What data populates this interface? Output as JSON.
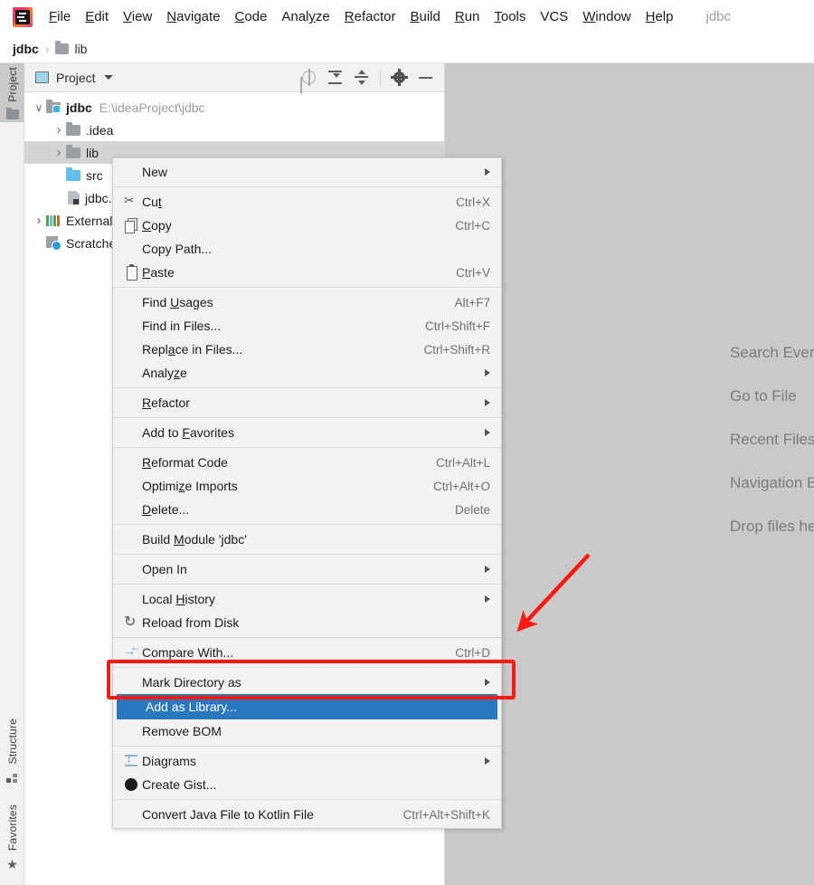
{
  "app": {
    "logo_icon": "intellij-idea-logo",
    "project_name": "jdbc"
  },
  "menubar": {
    "items": [
      {
        "label": "File",
        "mnemonic": "F"
      },
      {
        "label": "Edit",
        "mnemonic": "E"
      },
      {
        "label": "View",
        "mnemonic": "V"
      },
      {
        "label": "Navigate",
        "mnemonic": "N"
      },
      {
        "label": "Code",
        "mnemonic": "C"
      },
      {
        "label": "Analyze",
        "mnemonic": "y"
      },
      {
        "label": "Refactor",
        "mnemonic": "R"
      },
      {
        "label": "Build",
        "mnemonic": "B"
      },
      {
        "label": "Run",
        "mnemonic": "R"
      },
      {
        "label": "Tools",
        "mnemonic": "T"
      },
      {
        "label": "VCS",
        "mnemonic": ""
      },
      {
        "label": "Window",
        "mnemonic": "W"
      },
      {
        "label": "Help",
        "mnemonic": "H"
      }
    ]
  },
  "breadcrumb": {
    "root": "jdbc",
    "separator": "›",
    "folder_icon": "folder-icon",
    "current": "lib"
  },
  "stripe": {
    "buttons": [
      {
        "label": "Project",
        "icon": "folder-icon",
        "active": true
      },
      {
        "label": "Structure",
        "icon": "structure-icon",
        "active": false
      },
      {
        "label": "Favorites",
        "icon": "star-icon",
        "active": false
      }
    ]
  },
  "project_panel": {
    "title": "Project",
    "title_icon": "project-view-icon",
    "caret_icon": "chevron-down-icon",
    "toolbar": [
      {
        "name": "select-opened-file-icon",
        "tooltip": "Select Opened File"
      },
      {
        "name": "expand-all-icon",
        "tooltip": "Expand All"
      },
      {
        "name": "collapse-all-icon",
        "tooltip": "Collapse All"
      },
      {
        "name": "settings-gear-icon",
        "tooltip": "Settings"
      },
      {
        "name": "hide-icon",
        "tooltip": "Hide"
      }
    ],
    "tree": [
      {
        "label": "jdbc",
        "path": "E:\\ideaProject\\jdbc",
        "icon": "module-folder-icon",
        "arrow": "open",
        "indent": 0,
        "bold": true,
        "selected": false
      },
      {
        "label": ".idea",
        "path": "",
        "icon": "folder-icon",
        "arrow": "closed",
        "indent": 1,
        "bold": false,
        "selected": false
      },
      {
        "label": "lib",
        "path": "",
        "icon": "folder-icon",
        "arrow": "closed",
        "indent": 1,
        "bold": false,
        "selected": true
      },
      {
        "label": "src",
        "path": "",
        "icon": "source-folder-icon",
        "arrow": "none",
        "indent": 1,
        "bold": false,
        "selected": false
      },
      {
        "label": "jdbc.iml",
        "path": "",
        "icon": "iml-file-icon",
        "arrow": "none",
        "indent": 1,
        "bold": false,
        "selected": false
      },
      {
        "label": "External Libraries",
        "path": "",
        "icon": "external-libraries-icon",
        "arrow": "closed",
        "indent": 0,
        "bold": false,
        "selected": false
      },
      {
        "label": "Scratches and Consoles",
        "path": "",
        "icon": "scratches-icon",
        "arrow": "none",
        "indent": 0,
        "bold": false,
        "selected": false
      }
    ]
  },
  "editor": {
    "hints": [
      "Search Everywhere",
      "Go to File",
      "Recent Files",
      "Navigation Bar",
      "Drop files here to open"
    ]
  },
  "context_menu": {
    "items": [
      {
        "label": "New",
        "mnemonic": "",
        "shortcut": "",
        "icon": "",
        "submenu": true,
        "selected": false,
        "separator_after": true
      },
      {
        "label": "Cut",
        "mnemonic": "t",
        "shortcut": "Ctrl+X",
        "icon": "cut-icon",
        "submenu": false,
        "selected": false,
        "separator_after": false
      },
      {
        "label": "Copy",
        "mnemonic": "C",
        "shortcut": "Ctrl+C",
        "icon": "copy-icon",
        "submenu": false,
        "selected": false,
        "separator_after": false
      },
      {
        "label": "Copy Path...",
        "mnemonic": "",
        "shortcut": "",
        "icon": "",
        "submenu": false,
        "selected": false,
        "separator_after": false
      },
      {
        "label": "Paste",
        "mnemonic": "P",
        "shortcut": "Ctrl+V",
        "icon": "paste-icon",
        "submenu": false,
        "selected": false,
        "separator_after": true
      },
      {
        "label": "Find Usages",
        "mnemonic": "U",
        "shortcut": "Alt+F7",
        "icon": "",
        "submenu": false,
        "selected": false,
        "separator_after": false
      },
      {
        "label": "Find in Files...",
        "mnemonic": "",
        "shortcut": "Ctrl+Shift+F",
        "icon": "",
        "submenu": false,
        "selected": false,
        "separator_after": false
      },
      {
        "label": "Replace in Files...",
        "mnemonic": "a",
        "shortcut": "Ctrl+Shift+R",
        "icon": "",
        "submenu": false,
        "selected": false,
        "separator_after": false
      },
      {
        "label": "Analyze",
        "mnemonic": "z",
        "shortcut": "",
        "icon": "",
        "submenu": true,
        "selected": false,
        "separator_after": true
      },
      {
        "label": "Refactor",
        "mnemonic": "R",
        "shortcut": "",
        "icon": "",
        "submenu": true,
        "selected": false,
        "separator_after": true
      },
      {
        "label": "Add to Favorites",
        "mnemonic": "F",
        "shortcut": "",
        "icon": "",
        "submenu": true,
        "selected": false,
        "separator_after": true
      },
      {
        "label": "Reformat Code",
        "mnemonic": "R",
        "shortcut": "Ctrl+Alt+L",
        "icon": "",
        "submenu": false,
        "selected": false,
        "separator_after": false
      },
      {
        "label": "Optimize Imports",
        "mnemonic": "z",
        "shortcut": "Ctrl+Alt+O",
        "icon": "",
        "submenu": false,
        "selected": false,
        "separator_after": false
      },
      {
        "label": "Delete...",
        "mnemonic": "D",
        "shortcut": "Delete",
        "icon": "",
        "submenu": false,
        "selected": false,
        "separator_after": true
      },
      {
        "label": "Build Module 'jdbc'",
        "mnemonic": "M",
        "shortcut": "",
        "icon": "",
        "submenu": false,
        "selected": false,
        "separator_after": true
      },
      {
        "label": "Open In",
        "mnemonic": "",
        "shortcut": "",
        "icon": "",
        "submenu": true,
        "selected": false,
        "separator_after": true
      },
      {
        "label": "Local History",
        "mnemonic": "H",
        "shortcut": "",
        "icon": "",
        "submenu": true,
        "selected": false,
        "separator_after": false
      },
      {
        "label": "Reload from Disk",
        "mnemonic": "",
        "shortcut": "",
        "icon": "reload-icon",
        "submenu": false,
        "selected": false,
        "separator_after": true
      },
      {
        "label": "Compare With...",
        "mnemonic": "",
        "shortcut": "Ctrl+D",
        "icon": "compare-icon",
        "submenu": false,
        "selected": false,
        "separator_after": true
      },
      {
        "label": "Mark Directory as",
        "mnemonic": "",
        "shortcut": "",
        "icon": "",
        "submenu": true,
        "selected": false,
        "separator_after": false
      },
      {
        "label": "Add as Library...",
        "mnemonic": "",
        "shortcut": "",
        "icon": "",
        "submenu": false,
        "selected": true,
        "separator_after": false
      },
      {
        "label": "Remove BOM",
        "mnemonic": "",
        "shortcut": "",
        "icon": "",
        "submenu": false,
        "selected": false,
        "separator_after": true
      },
      {
        "label": "Diagrams",
        "mnemonic": "",
        "shortcut": "",
        "icon": "diagrams-icon",
        "submenu": true,
        "selected": false,
        "separator_after": false
      },
      {
        "label": "Create Gist...",
        "mnemonic": "",
        "shortcut": "",
        "icon": "github-gist-icon",
        "submenu": false,
        "selected": false,
        "separator_after": true
      },
      {
        "label": "Convert Java File to Kotlin File",
        "mnemonic": "",
        "shortcut": "Ctrl+Alt+Shift+K",
        "icon": "",
        "submenu": false,
        "selected": false,
        "separator_after": false
      }
    ]
  },
  "annotations": {
    "highlight_box_color": "#fb1a11",
    "arrow_color": "#fb1a11",
    "selection_color": "#2b77bf"
  }
}
